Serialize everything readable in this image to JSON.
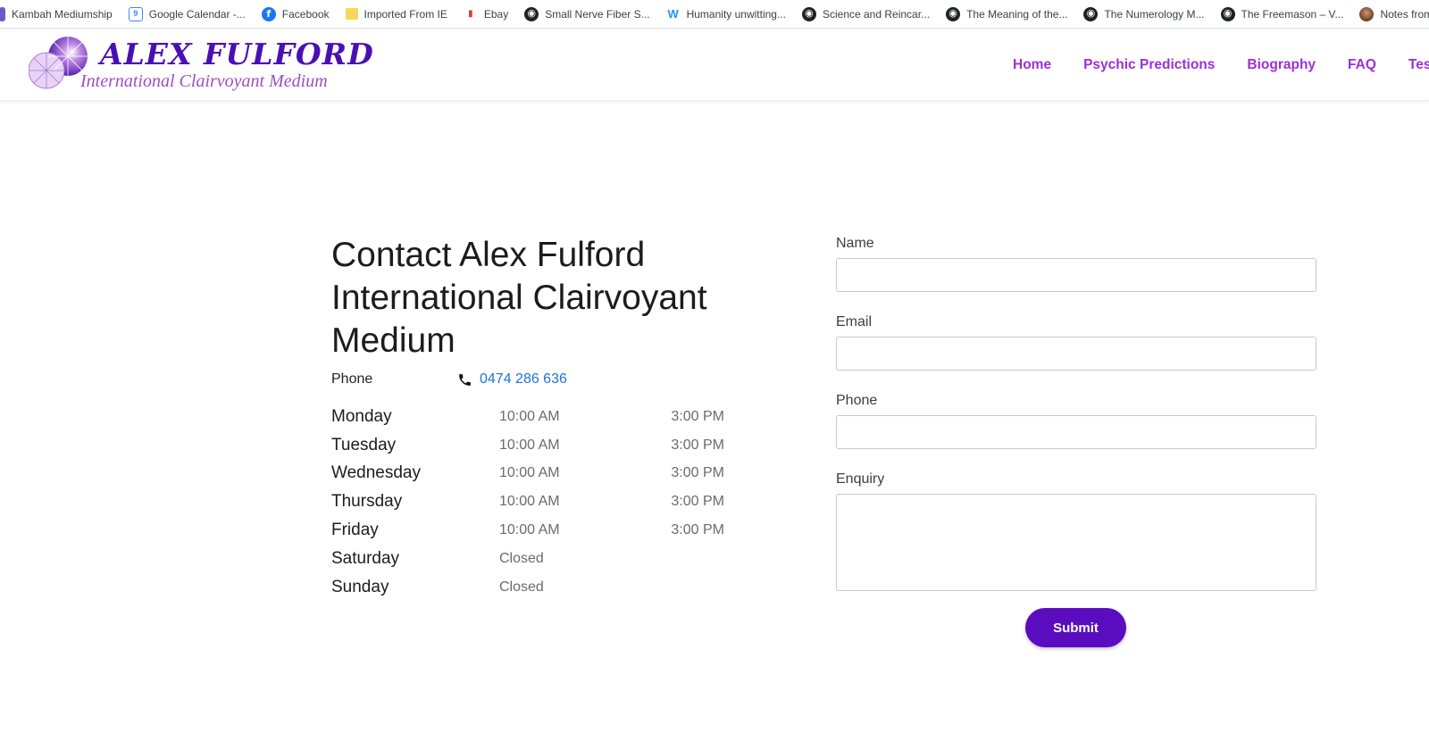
{
  "bookmarks": [
    {
      "label": "Kambah Mediumship",
      "icon": "kambah-icon"
    },
    {
      "label": "Google Calendar -...",
      "icon": "google-calendar-icon"
    },
    {
      "label": "Facebook",
      "icon": "facebook-icon"
    },
    {
      "label": "Imported From IE",
      "icon": "folder-icon"
    },
    {
      "label": "Ebay",
      "icon": "ebay-icon"
    },
    {
      "label": "Small Nerve Fiber S...",
      "icon": "globe-icon"
    },
    {
      "label": "Humanity unwitting...",
      "icon": "weebly-icon"
    },
    {
      "label": "Science and Reincar...",
      "icon": "globe-icon"
    },
    {
      "label": "The Meaning of the...",
      "icon": "globe-icon"
    },
    {
      "label": "The Numerology M...",
      "icon": "globe-icon"
    },
    {
      "label": "The Freemason – V...",
      "icon": "globe-icon"
    },
    {
      "label": "Notes from a High",
      "icon": "avatar-icon"
    }
  ],
  "logo": {
    "title": "ALEX FULFORD",
    "subtitle": "International Clairvoyant Medium"
  },
  "nav": {
    "home": "Home",
    "predictions": "Psychic Predictions",
    "biography": "Biography",
    "faq": "FAQ",
    "testimonials": "Testi"
  },
  "contact": {
    "title": "Contact Alex Fulford International Clairvoyant Medium",
    "phone_label": "Phone",
    "phone_number": "0474 286 636"
  },
  "hours": [
    {
      "day": "Monday",
      "open": "10:00 AM",
      "close": "3:00 PM"
    },
    {
      "day": "Tuesday",
      "open": "10:00 AM",
      "close": "3:00 PM"
    },
    {
      "day": "Wednesday",
      "open": "10:00 AM",
      "close": "3:00 PM"
    },
    {
      "day": "Thursday",
      "open": "10:00 AM",
      "close": "3:00 PM"
    },
    {
      "day": "Friday",
      "open": "10:00 AM",
      "close": "3:00 PM"
    },
    {
      "day": "Saturday",
      "open": "Closed",
      "close": ""
    },
    {
      "day": "Sunday",
      "open": "Closed",
      "close": ""
    }
  ],
  "form": {
    "name_label": "Name",
    "name_value": "",
    "email_label": "Email",
    "email_value": "",
    "phone_label": "Phone",
    "phone_value": "",
    "enquiry_label": "Enquiry",
    "enquiry_value": "",
    "submit_label": "Submit"
  },
  "colors": {
    "brand_purple": "#4a0fb3",
    "nav_purple": "#9d2fd3",
    "button_purple": "#5a0dbe",
    "link_blue": "#1e73d8"
  }
}
